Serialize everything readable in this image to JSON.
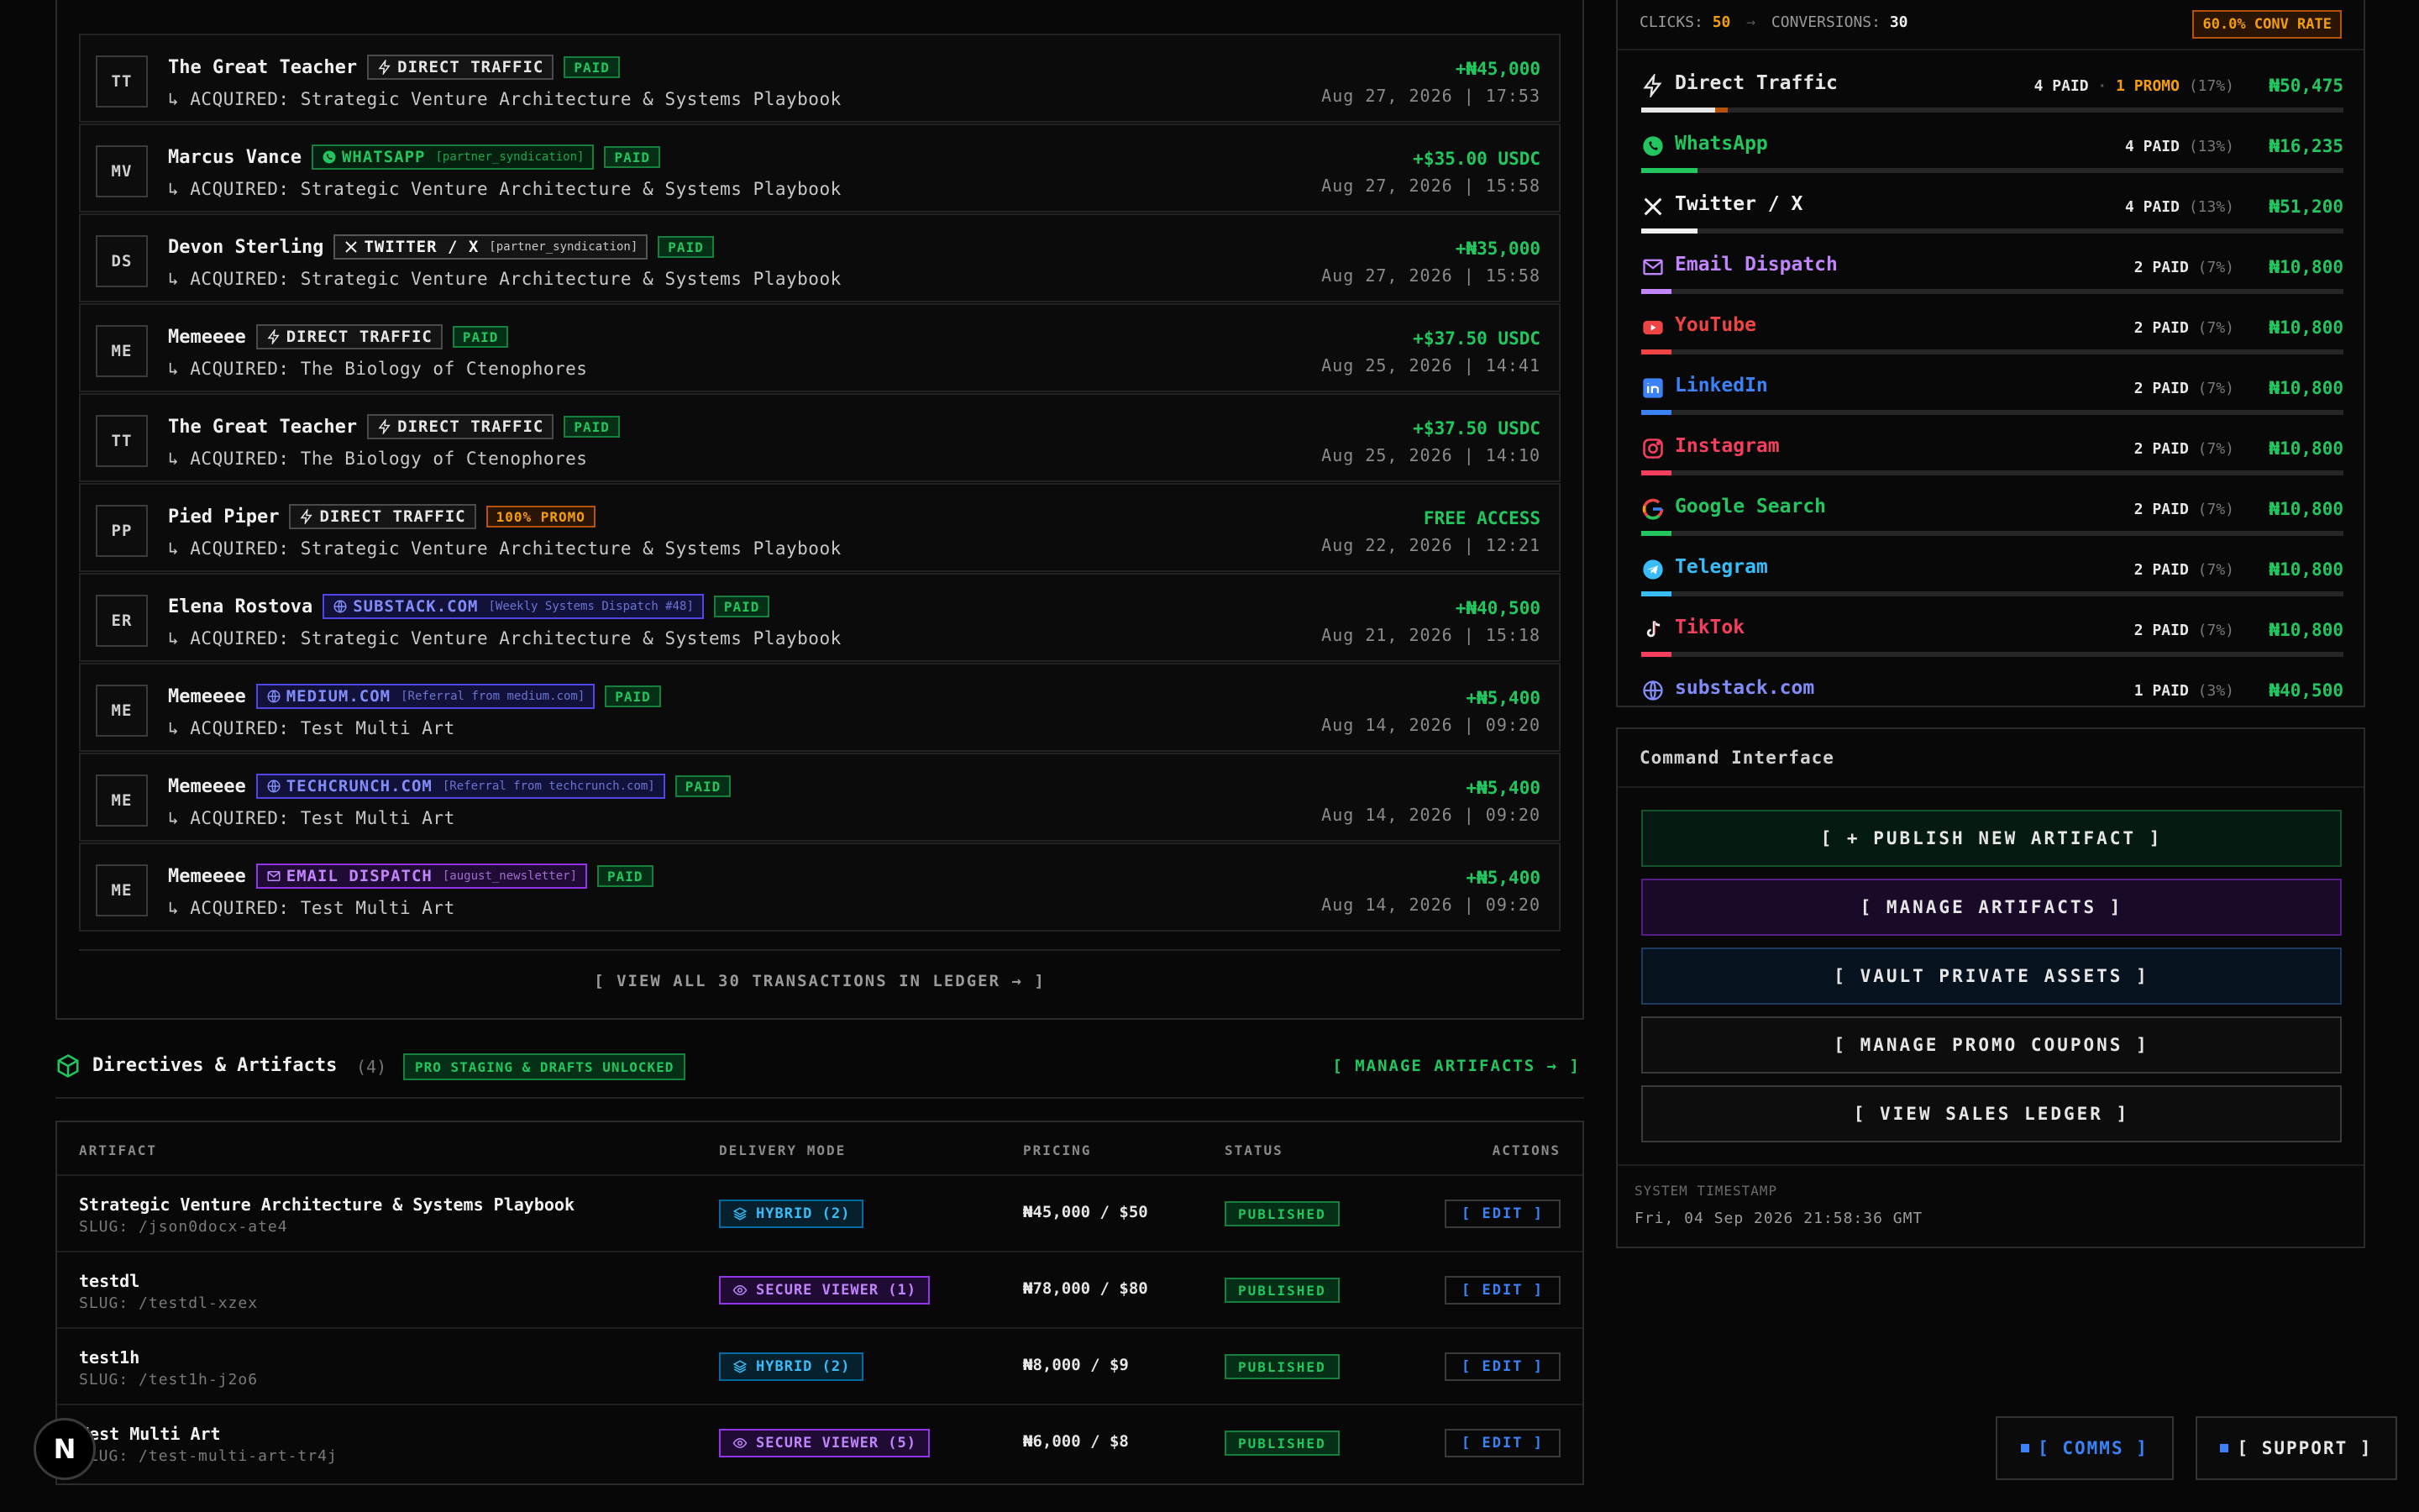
{
  "transactions": {
    "rows": [
      {
        "initials": "TT",
        "name": "The Great Teacher",
        "source": {
          "label": "DIRECT TRAFFIC",
          "sub": "",
          "type": "direct"
        },
        "status": "PAID",
        "status_type": "paid",
        "item": "↳ ACQUIRED: Strategic Venture Architecture & Systems Playbook",
        "amount": "+₦45,000",
        "date": "Aug 27, 2026 | 17:53"
      },
      {
        "initials": "MV",
        "name": "Marcus Vance",
        "source": {
          "label": "WHATSAPP",
          "sub": "[partner_syndication]",
          "type": "whatsapp"
        },
        "status": "PAID",
        "status_type": "paid",
        "item": "↳ ACQUIRED: Strategic Venture Architecture & Systems Playbook",
        "amount": "+$35.00 USDC",
        "date": "Aug 27, 2026 | 15:58"
      },
      {
        "initials": "DS",
        "name": "Devon Sterling",
        "source": {
          "label": "TWITTER / X",
          "sub": "[partner_syndication]",
          "type": "twitter"
        },
        "status": "PAID",
        "status_type": "paid",
        "item": "↳ ACQUIRED: Strategic Venture Architecture & Systems Playbook",
        "amount": "+₦35,000",
        "date": "Aug 27, 2026 | 15:58"
      },
      {
        "initials": "ME",
        "name": "Memeeee",
        "source": {
          "label": "DIRECT TRAFFIC",
          "sub": "",
          "type": "direct"
        },
        "status": "PAID",
        "status_type": "paid",
        "item": "↳ ACQUIRED: The Biology of Ctenophores",
        "amount": "+$37.50 USDC",
        "date": "Aug 25, 2026 | 14:41"
      },
      {
        "initials": "TT",
        "name": "The Great Teacher",
        "source": {
          "label": "DIRECT TRAFFIC",
          "sub": "",
          "type": "direct"
        },
        "status": "PAID",
        "status_type": "paid",
        "item": "↳ ACQUIRED: The Biology of Ctenophores",
        "amount": "+$37.50 USDC",
        "date": "Aug 25, 2026 | 14:10"
      },
      {
        "initials": "PP",
        "name": "Pied Piper",
        "source": {
          "label": "DIRECT TRAFFIC",
          "sub": "",
          "type": "direct"
        },
        "status": "100% PROMO",
        "status_type": "promo",
        "item": "↳ ACQUIRED: Strategic Venture Architecture & Systems Playbook",
        "amount": "FREE ACCESS",
        "date": "Aug 22, 2026 | 12:21"
      },
      {
        "initials": "ER",
        "name": "Elena Rostova",
        "source": {
          "label": "SUBSTACK.COM",
          "sub": "[Weekly Systems Dispatch #48]",
          "type": "web"
        },
        "status": "PAID",
        "status_type": "paid",
        "item": "↳ ACQUIRED: Strategic Venture Architecture & Systems Playbook",
        "amount": "+₦40,500",
        "date": "Aug 21, 2026 | 15:18"
      },
      {
        "initials": "ME",
        "name": "Memeeee",
        "source": {
          "label": "MEDIUM.COM",
          "sub": "[Referral from medium.com]",
          "type": "web"
        },
        "status": "PAID",
        "status_type": "paid",
        "item": "↳ ACQUIRED: Test Multi Art",
        "amount": "+₦5,400",
        "date": "Aug 14, 2026 | 09:20"
      },
      {
        "initials": "ME",
        "name": "Memeeee",
        "source": {
          "label": "TECHCRUNCH.COM",
          "sub": "[Referral from techcrunch.com]",
          "type": "web"
        },
        "status": "PAID",
        "status_type": "paid",
        "item": "↳ ACQUIRED: Test Multi Art",
        "amount": "+₦5,400",
        "date": "Aug 14, 2026 | 09:20"
      },
      {
        "initials": "ME",
        "name": "Memeeee",
        "source": {
          "label": "EMAIL DISPATCH",
          "sub": "[august_newsletter]",
          "type": "email"
        },
        "status": "PAID",
        "status_type": "paid",
        "item": "↳ ACQUIRED: Test Multi Art",
        "amount": "+₦5,400",
        "date": "Aug 14, 2026 | 09:20"
      }
    ],
    "view_all": "[ VIEW ALL 30 TRANSACTIONS IN LEDGER → ]"
  },
  "artifacts": {
    "title": "Directives & Artifacts",
    "count": "(4)",
    "badge": "PRO STAGING & DRAFTS UNLOCKED",
    "manage_link": "[ MANAGE ARTIFACTS → ]",
    "columns": [
      "ARTIFACT",
      "DELIVERY MODE",
      "PRICING",
      "STATUS",
      "ACTIONS"
    ],
    "rows": [
      {
        "name": "Strategic Venture Architecture & Systems Playbook",
        "slug": "SLUG: /json0docx-ate4",
        "mode": "HYBRID (2)",
        "mode_type": "hybrid",
        "price": "₦45,000 / $50",
        "status": "PUBLISHED",
        "action": "[ EDIT ]"
      },
      {
        "name": "testdl",
        "slug": "SLUG: /testdl-xzex",
        "mode": "SECURE VIEWER (1)",
        "mode_type": "viewer",
        "price": "₦78,000 / $80",
        "status": "PUBLISHED",
        "action": "[ EDIT ]"
      },
      {
        "name": "test1h",
        "slug": "SLUG: /test1h-j2o6",
        "mode": "HYBRID (2)",
        "mode_type": "hybrid",
        "price": "₦8,000 / $9",
        "status": "PUBLISHED",
        "action": "[ EDIT ]"
      },
      {
        "name": "Test Multi Art",
        "slug": "SLUG: /test-multi-art-tr4j",
        "mode": "SECURE VIEWER (5)",
        "mode_type": "viewer",
        "price": "₦6,000 / $8",
        "status": "PUBLISHED",
        "action": "[ EDIT ]"
      }
    ]
  },
  "sources": {
    "stats": {
      "clicks_label": "CLICKS:",
      "clicks": "50",
      "arrow": "→",
      "conversions_label": "CONVERSIONS:",
      "conversions": "30",
      "conv_rate": "60.0% CONV RATE"
    },
    "items": [
      {
        "name": "Direct Traffic",
        "icon": "lightning-icon",
        "color": "#e6e6e6",
        "paid": "4 PAID",
        "promo": "1 PROMO",
        "pct": "(17%)",
        "revenue": "₦50,475",
        "share": 0.17,
        "promo_share": 0.03
      },
      {
        "name": "WhatsApp",
        "icon": "whatsapp-icon",
        "color": "#22c55e",
        "paid": "4 PAID",
        "promo": "",
        "pct": "(13%)",
        "revenue": "₦16,235",
        "share": 0.13,
        "promo_share": 0
      },
      {
        "name": "Twitter / X",
        "icon": "x-icon",
        "color": "#f2f2f2",
        "paid": "4 PAID",
        "promo": "",
        "pct": "(13%)",
        "revenue": "₦51,200",
        "share": 0.13,
        "promo_share": 0
      },
      {
        "name": "Email Dispatch",
        "icon": "mail-icon",
        "color": "#c084fc",
        "paid": "2 PAID",
        "promo": "",
        "pct": "(7%)",
        "revenue": "₦10,800",
        "share": 0.07,
        "promo_share": 0
      },
      {
        "name": "YouTube",
        "icon": "youtube-icon",
        "color": "#ef4444",
        "paid": "2 PAID",
        "promo": "",
        "pct": "(7%)",
        "revenue": "₦10,800",
        "share": 0.07,
        "promo_share": 0
      },
      {
        "name": "LinkedIn",
        "icon": "linkedin-icon",
        "color": "#3b82f6",
        "paid": "2 PAID",
        "promo": "",
        "pct": "(7%)",
        "revenue": "₦10,800",
        "share": 0.07,
        "promo_share": 0
      },
      {
        "name": "Instagram",
        "icon": "instagram-icon",
        "color": "#f43f5e",
        "paid": "2 PAID",
        "promo": "",
        "pct": "(7%)",
        "revenue": "₦10,800",
        "share": 0.07,
        "promo_share": 0
      },
      {
        "name": "Google Search",
        "icon": "google-icon",
        "color": "#22c55e",
        "paid": "2 PAID",
        "promo": "",
        "pct": "(7%)",
        "revenue": "₦10,800",
        "share": 0.07,
        "promo_share": 0
      },
      {
        "name": "Telegram",
        "icon": "telegram-icon",
        "color": "#38bdf8",
        "paid": "2 PAID",
        "promo": "",
        "pct": "(7%)",
        "revenue": "₦10,800",
        "share": 0.07,
        "promo_share": 0
      },
      {
        "name": "TikTok",
        "icon": "tiktok-icon",
        "color": "#f43f5e",
        "paid": "2 PAID",
        "promo": "",
        "pct": "(7%)",
        "revenue": "₦10,800",
        "share": 0.07,
        "promo_share": 0
      },
      {
        "name": "substack.com",
        "icon": "globe-icon",
        "color": "#818cf8",
        "paid": "1 PAID",
        "promo": "",
        "pct": "(3%)",
        "revenue": "₦40,500",
        "share": 0.03,
        "promo_share": 0
      }
    ]
  },
  "command": {
    "title": "Command Interface",
    "buttons": [
      {
        "label": "[ + PUBLISH NEW ARTIFACT ]",
        "style": "green"
      },
      {
        "label": "[ MANAGE ARTIFACTS ]",
        "style": "purple"
      },
      {
        "label": "[ VAULT PRIVATE ASSETS ]",
        "style": "blue"
      },
      {
        "label": "[ MANAGE PROMO COUPONS ]",
        "style": "gray"
      },
      {
        "label": "[ VIEW SALES LEDGER ]",
        "style": "gray"
      }
    ],
    "timestamp_label": "SYSTEM TIMESTAMP",
    "timestamp": "Fri, 04 Sep 2026 21:58:36 GMT"
  },
  "footer": {
    "comms": "[ COMMS ]",
    "support": "[ SUPPORT ]",
    "nextjs_badge": "N"
  }
}
